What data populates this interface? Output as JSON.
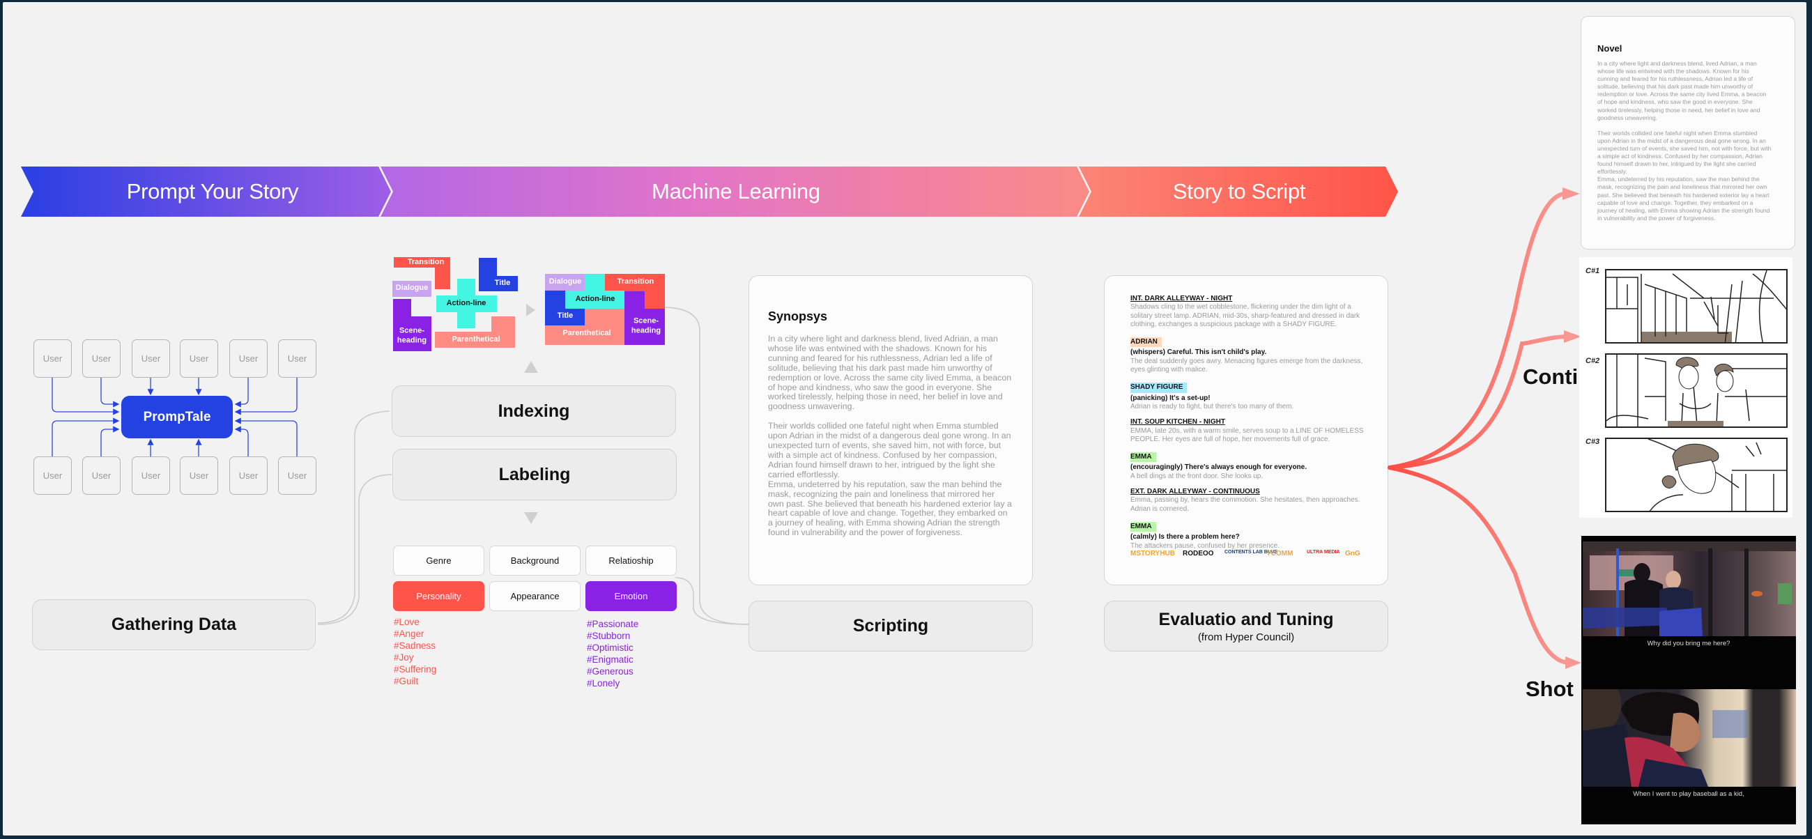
{
  "banner": {
    "stages": [
      {
        "label": "Prompt Your Story"
      },
      {
        "label": "Machine Learning"
      },
      {
        "label": "Story to Script"
      }
    ],
    "colors": {
      "start": "#2a3fe3",
      "mid": "#b86ae6",
      "pink": "#f78593",
      "end": "#ff554a"
    }
  },
  "gathering": {
    "hub_label": "PrompTale",
    "user_label": "User",
    "user_count_top": 6,
    "user_count_bottom": 6,
    "step_label": "Gathering Data"
  },
  "ml": {
    "puzzle_before": [
      "Transition",
      "Dialogue",
      "Title",
      "Action-line",
      "Scene-\nheading",
      "Parenthetical"
    ],
    "puzzle_after": [
      "Dialogue",
      "Transition",
      "Action-line",
      "Title",
      "Scene-\nheading",
      "Parenthetical"
    ],
    "indexing_label": "Indexing",
    "labeling_label": "Labeling",
    "tags": [
      {
        "label": "Genre",
        "style": "plain"
      },
      {
        "label": "Background",
        "style": "plain"
      },
      {
        "label": "Relatioship",
        "style": "plain"
      },
      {
        "label": "Personality",
        "style": "red"
      },
      {
        "label": "Appearance",
        "style": "plain"
      },
      {
        "label": "Emotion",
        "style": "purple"
      }
    ],
    "personality_hashtags": [
      "#Love",
      "#Anger",
      "#Sadness",
      "#Joy",
      "#Suffering",
      "#Guilt"
    ],
    "emotion_hashtags": [
      "#Passionate",
      "#Stubborn",
      "#Optimistic",
      "#Enigmatic",
      "#Generous",
      "#Lonely"
    ],
    "colors": {
      "red": "#ff544a",
      "purple": "#8a22e5",
      "cyan": "#45f5e3",
      "blue": "#2441e2",
      "lavender": "#c7a3f0",
      "salmon": "#ff8b82"
    }
  },
  "synopsis": {
    "title": "Synopsys",
    "paragraph1": "In a city where light and darkness blend, lived Adrian, a man whose life was entwined with the shadows. Known for his cunning and feared for his ruthlessness, Adrian led a life of solitude, believing that his dark past made him unworthy of redemption or love. Across the same city lived Emma, a beacon of hope and kindness, who saw the good in everyone. She worked tirelessly, helping those in need, her belief in love and goodness unwavering.",
    "paragraph2": "Their worlds collided one fateful night when Emma stumbled upon Adrian in the midst of a dangerous deal gone wrong. In an unexpected turn of events, she saved him, not with force, but with a simple act of kindness. Confused by her compassion, Adrian found himself drawn to her, intrigued by the light she carried effortlessly.",
    "paragraph3": "Emma, undeterred by his reputation, saw the man behind the mask, recognizing the pain and loneliness that mirrored her own past. She believed that beneath his hardened exterior lay a heart capable of love and change. Together, they embarked on a journey of healing, with Emma showing Adrian the strength found in vulnerability and the power of forgiveness.",
    "step_label": "Scripting"
  },
  "script": {
    "scene1_heading": "INT. DARK ALLEYWAY - NIGHT",
    "scene1_action": "Shadows cling to the wet cobblestone, flickering under the dim light of a solitary street lamp. ADRIAN, mid-30s, sharp-featured and dressed in dark clothing, exchanges a suspicious package with a SHADY FIGURE.",
    "char1": "ADRIAN",
    "dlg1": "(whispers) Careful. This isn't child's play.",
    "action2": "The deal suddenly goes awry. Menacing figures emerge from the darkness, eyes glinting with malice.",
    "char2": "SHADY FIGURE",
    "dlg2": "(panicking) It's a set-up!",
    "action3": "Adrian is ready to fight, but there's too many of them.",
    "scene2_heading": "INT. SOUP KITCHEN - NIGHT",
    "scene2_action": "EMMA, late 20s, with a warm smile, serves soup to a LINE OF HOMELESS PEOPLE. Her eyes are full of hope, her movements full of grace.",
    "char3": "EMMA",
    "dlg3": "(encouragingly) There's always enough for everyone.",
    "action4": "A bell dings at the front door. She looks up.",
    "scene3_heading": "EXT. DARK ALLEYWAY - CONTINUOUS",
    "scene3_action": "Emma, passing by, hears the commotion. She hesitates, then approaches. Adrian is cornered.",
    "char4": "EMMA",
    "dlg4": "(calmly) Is there a problem here?",
    "action5": "The attackers pause, confused by her presence.",
    "char_colors": {
      "ADRIAN": "#ffd9bd",
      "SHADY FIGURE": "#a6e8ff",
      "EMMA": "#b8f7a6"
    },
    "logos": [
      {
        "label": "MSTORYHUB",
        "color": "#f5a623"
      },
      {
        "label": "RODEOO",
        "color": "#111111"
      },
      {
        "label": "CONTENTS LAB BLUE",
        "color": "#1d3a8a"
      },
      {
        "label": "YCOMM",
        "color": "#e0a85a"
      },
      {
        "label": "ULTRA MEDIA",
        "color": "#e0202a"
      },
      {
        "label": "GnG",
        "color": "#f0a030"
      }
    ],
    "step_label": "Evaluatio and Tuning",
    "step_sublabel": "(from Hyper Council)"
  },
  "outputs": {
    "novel": {
      "title": "Novel",
      "paragraph1": "In a city where light and darkness blend, lived Adrian, a man whose life was entwined with the shadows. Known for his cunning and feared for his ruthlessness, Adrian led a life of solitude, believing that his dark past made him unworthy of redemption or love. Across the same city lived Emma, a beacon of hope and kindness, who saw the good in everyone. She worked tirelessly, helping those in need, her belief in love and goodness unwavering.",
      "paragraph2": "Their worlds collided one fateful night when Emma stumbled upon Adrian in the midst of a dangerous deal gone wrong. In an unexpected turn of events, she saved him, not with force, but with a simple act of kindness. Confused by her compassion, Adrian found himself drawn to her, intrigued by the light she carried effortlessly.",
      "paragraph3": "Emma, undeterred by his reputation, saw the man behind the mask, recognizing the pain and loneliness that mirrored her own past. She believed that beneath his hardened exterior lay a heart capable of love and change. Together, they embarked on a journey of healing, with Emma showing Adrian the strength found in vulnerability and the power of forgiveness."
    },
    "conti": {
      "label": "Conti",
      "cuts": [
        "C#1",
        "C#2",
        "C#3"
      ]
    },
    "shot": {
      "label": "Shot",
      "subtitles": [
        "Why did you bring me here?",
        "When I went to play baseball as a kid,"
      ]
    },
    "arrow_color": "#ff5a4f"
  }
}
